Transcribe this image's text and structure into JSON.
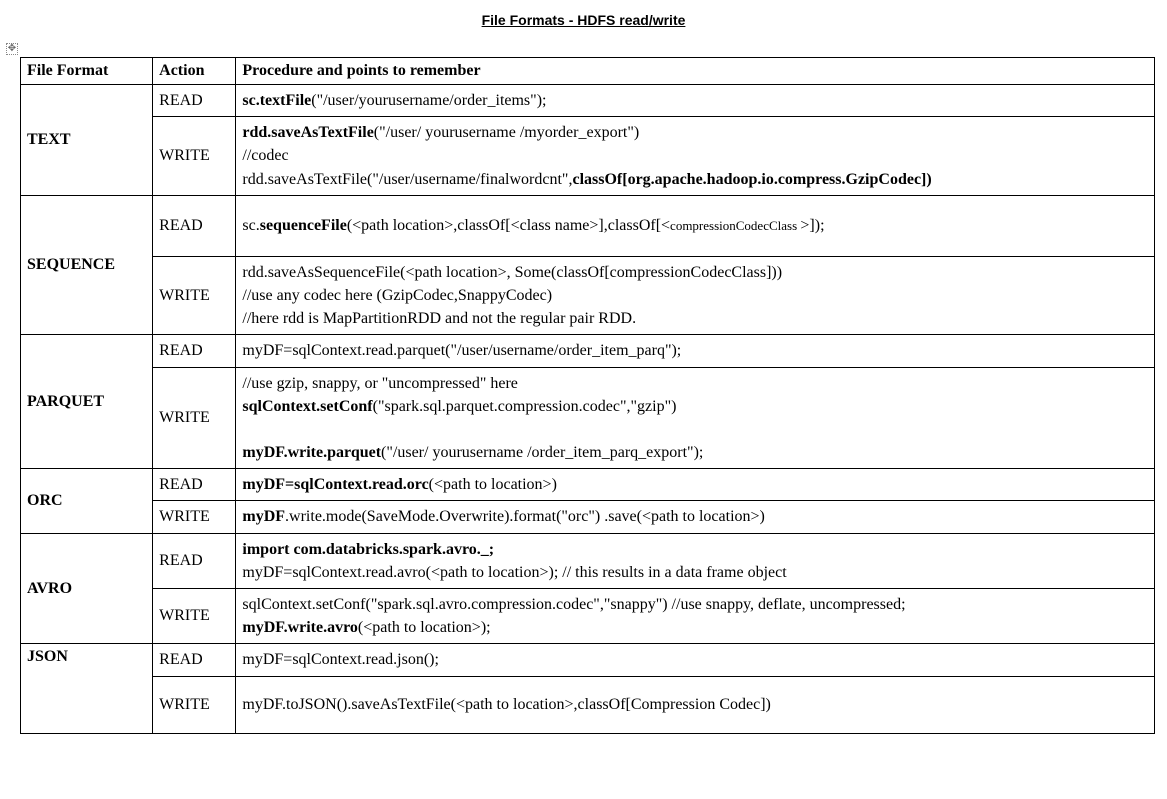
{
  "title": "File Formats  - HDFS read/write",
  "headers": {
    "c1": "File Format",
    "c2": "Action",
    "c3": "Procedure and points to remember"
  },
  "text": {
    "read": {
      "b1": "sc.textFile",
      "t1": "(\"/user/yourusername/order_items\");"
    },
    "write": {
      "b1": "rdd.saveAsTextFile",
      "t1": "(\"/user/ yourusername /myorder_export\")",
      "t2": "//codec",
      "t3": "rdd.saveAsTextFile(\"/user/username/finalwordcnt\",",
      "b2": "classOf[org.apache.hadoop.io.compress.GzipCodec])"
    }
  },
  "sequence": {
    "read": {
      "t1": "sc.",
      "b1": "sequenceFile",
      "t2": "(<path location>,classOf[<class name>],classOf[<",
      "s1": "compressionCodecClass ",
      "t3": ">]);"
    },
    "write": {
      "t1": "rdd.saveAsSequenceFile(<path location>, Some(classOf[compressionCodecClass]))",
      "t2": "//use any codec here (GzipCodec,SnappyCodec)",
      "t3": "//here rdd is MapPartitionRDD and not the regular pair RDD."
    }
  },
  "parquet": {
    "read": {
      "t1": "myDF=sqlContext.read.parquet(\"/user/username/order_item_parq\");"
    },
    "write": {
      "t1": "//use gzip, snappy, or \"uncompressed\" here",
      "b1": "sqlContext.setConf",
      "t2": "(\"spark.sql.parquet.compression.codec\",\"gzip\")",
      "b2": "myDF.write.parquet",
      "t3": "(\"/user/ yourusername /order_item_parq_export\");"
    }
  },
  "orc": {
    "read": {
      "b1": "myDF=sqlContext.read.orc",
      "t1": "(<path to location>)"
    },
    "write": {
      "b1": "myDF",
      "t1": ".write.mode(SaveMode.Overwrite).format(\"orc\") .save(<path to location>)"
    }
  },
  "avro": {
    "read": {
      "b1": "import com.databricks.spark.avro._;",
      "t1": "myDF=sqlContext.read.avro(<path to location>); // this results in a data frame object"
    },
    "write": {
      "t1": "sqlContext.setConf(\"spark.sql.avro.compression.codec\",\"snappy\") //use snappy, deflate, uncompressed;",
      "b1": "myDF.write.avro",
      "t2": "(<path to location>);"
    }
  },
  "json": {
    "read": {
      "t1": "myDF=sqlContext.read.json();"
    },
    "write": {
      "t1": "myDF.toJSON().saveAsTextFile(<path to location>,classOf[Compression Codec])"
    }
  },
  "labels": {
    "text": "TEXT",
    "sequence": "SEQUENCE",
    "parquet": "PARQUET",
    "orc": "ORC",
    "avro": "AVRO",
    "json": "JSON",
    "read": "READ",
    "write": "WRITE"
  }
}
